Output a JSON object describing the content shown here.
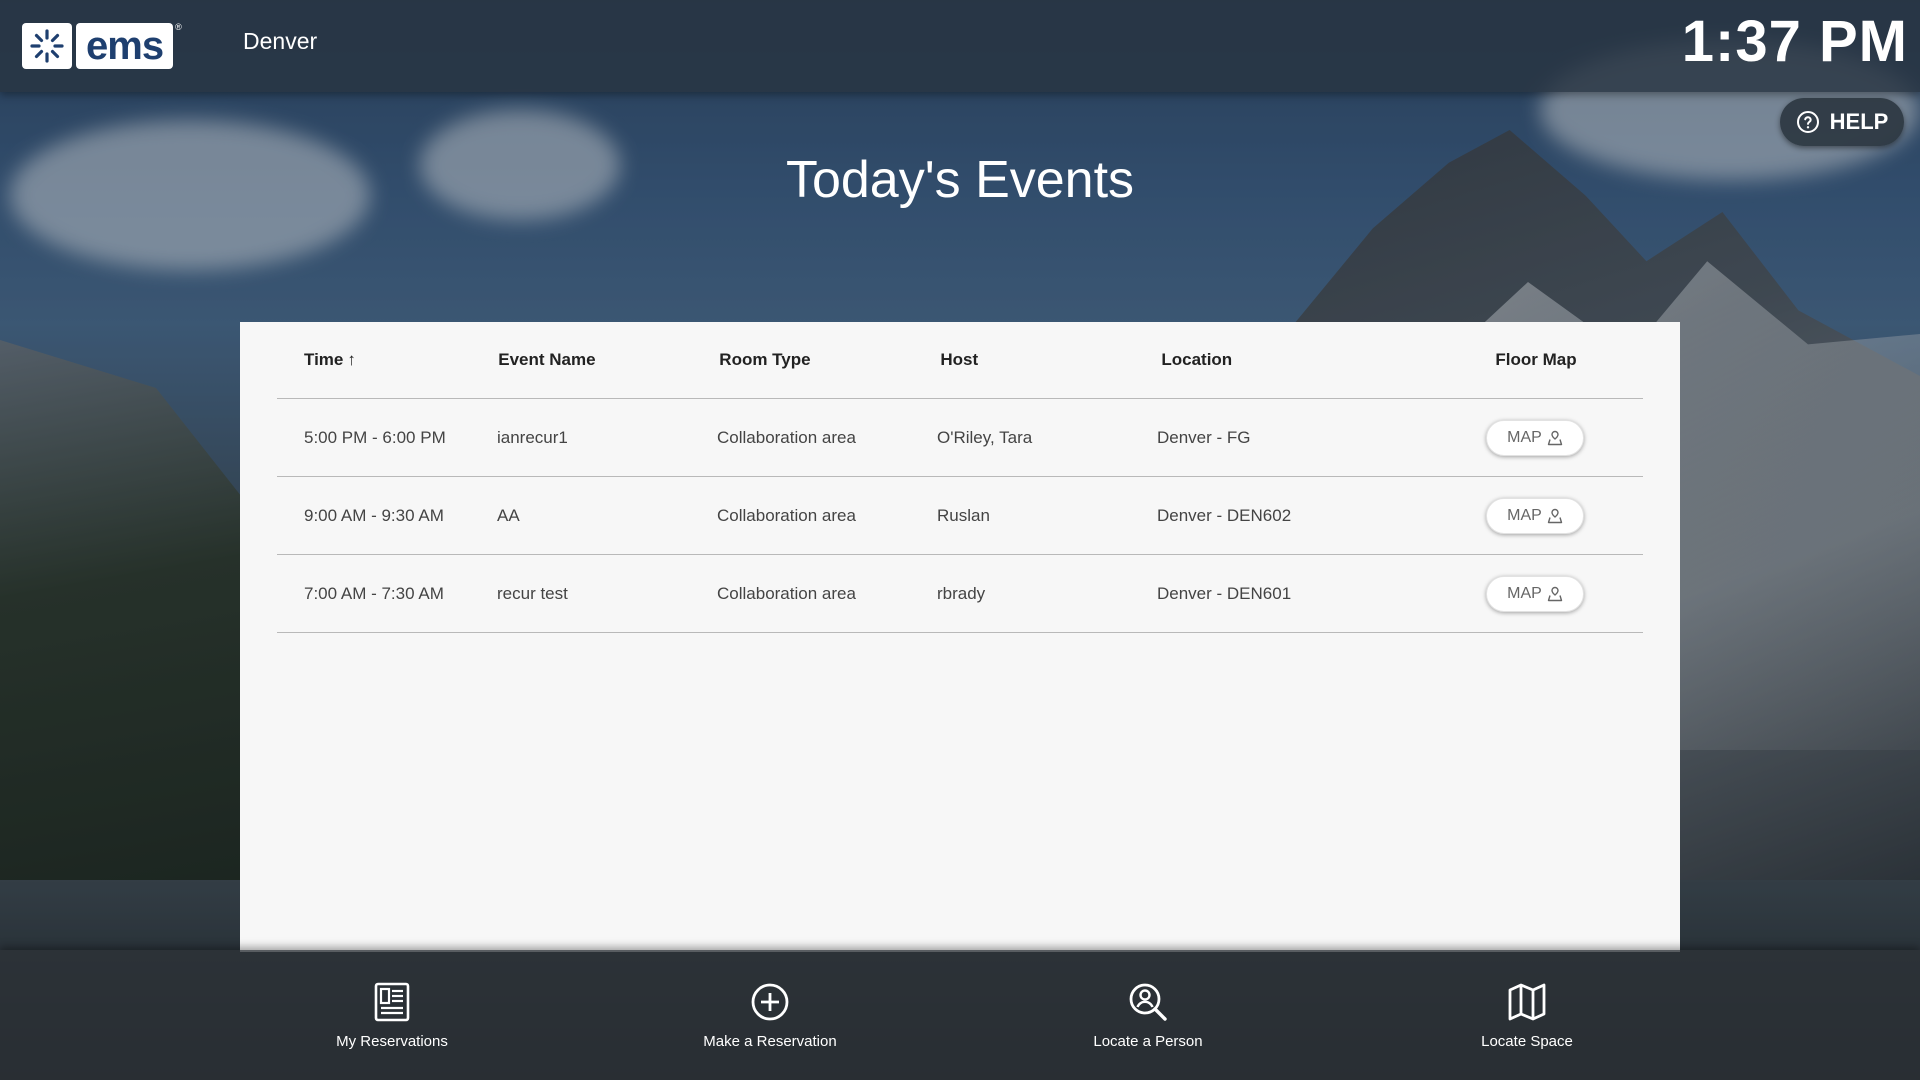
{
  "header": {
    "logo_text": "ems",
    "logo_reg": "®",
    "city": "Denver",
    "time": "1:37 PM"
  },
  "help": {
    "label": "HELP"
  },
  "page_title": "Today's Events",
  "table": {
    "columns": [
      "Time",
      "Event Name",
      "Room Type",
      "Host",
      "Location",
      "Floor Map"
    ],
    "sort_indicator": "↑",
    "rows": [
      {
        "time": "5:00 PM - 6:00 PM",
        "event": "ianrecur1",
        "room": "Collaboration area",
        "host": "O'Riley, Tara",
        "location": "Denver - FG",
        "map": "MAP"
      },
      {
        "time": "9:00 AM - 9:30 AM",
        "event": "AA",
        "room": "Collaboration area",
        "host": "Ruslan",
        "location": "Denver - DEN602",
        "map": "MAP"
      },
      {
        "time": "7:00 AM - 7:30 AM",
        "event": "recur test",
        "room": "Collaboration area",
        "host": "rbrady",
        "location": "Denver - DEN601",
        "map": "MAP"
      }
    ]
  },
  "nav": {
    "items": [
      {
        "label": "My Reservations",
        "icon": "reservations-icon"
      },
      {
        "label": "Make a Reservation",
        "icon": "plus-circle-icon"
      },
      {
        "label": "Locate a Person",
        "icon": "search-person-icon"
      },
      {
        "label": "Locate Space",
        "icon": "map-icon"
      }
    ]
  },
  "colors": {
    "brand": "#1e3f6f",
    "panel": "#f7f7f7",
    "header_bg": "#28343f",
    "text_light": "#ffffff"
  }
}
